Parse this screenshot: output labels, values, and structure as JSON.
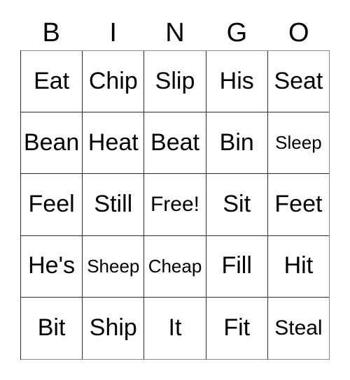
{
  "card": {
    "title": "BINGO",
    "header_letters": [
      "B",
      "I",
      "N",
      "G",
      "O"
    ],
    "colors": {
      "background": "#ffffff",
      "text": "#000000",
      "grid_line": "#2b2b2b",
      "outer_border": "#8a8a8a"
    },
    "grid": {
      "columns": 5,
      "rows": 5,
      "free_space": "Free!",
      "free_space_position": {
        "row": 3,
        "column": 3
      }
    },
    "rows": [
      {
        "cells": [
          {
            "label": "Eat",
            "size": "size-lg"
          },
          {
            "label": "Chip",
            "size": "size-lg"
          },
          {
            "label": "Slip",
            "size": "size-lg"
          },
          {
            "label": "His",
            "size": "size-lg"
          },
          {
            "label": "Seat",
            "size": "size-lg"
          }
        ]
      },
      {
        "cells": [
          {
            "label": "Bean",
            "size": "size-lg"
          },
          {
            "label": "Heat",
            "size": "size-lg"
          },
          {
            "label": "Beat",
            "size": "size-lg"
          },
          {
            "label": "Bin",
            "size": "size-lg"
          },
          {
            "label": "Sleep",
            "size": "size-sm"
          }
        ]
      },
      {
        "cells": [
          {
            "label": "Feel",
            "size": "size-lg"
          },
          {
            "label": "Still",
            "size": "size-lg"
          },
          {
            "label": "Free!",
            "size": "size-md"
          },
          {
            "label": "Sit",
            "size": "size-lg"
          },
          {
            "label": "Feet",
            "size": "size-lg"
          }
        ]
      },
      {
        "cells": [
          {
            "label": "He's",
            "size": "size-lg"
          },
          {
            "label": "Sheep",
            "size": "size-sm"
          },
          {
            "label": "Cheap",
            "size": "size-sm"
          },
          {
            "label": "Fill",
            "size": "size-lg"
          },
          {
            "label": "Hit",
            "size": "size-lg"
          }
        ]
      },
      {
        "cells": [
          {
            "label": "Bit",
            "size": "size-lg"
          },
          {
            "label": "Ship",
            "size": "size-lg"
          },
          {
            "label": "It",
            "size": "size-lg"
          },
          {
            "label": "Fit",
            "size": "size-lg"
          },
          {
            "label": "Steal",
            "size": "size-md"
          }
        ]
      }
    ]
  }
}
